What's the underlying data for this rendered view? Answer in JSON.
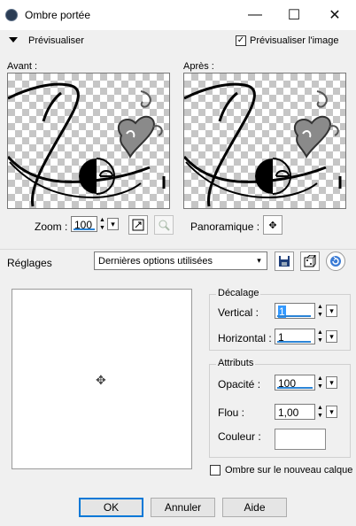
{
  "window": {
    "title": "Ombre portée",
    "minimize_glyph": "—",
    "maximize_glyph": "☐",
    "close_glyph": "✕"
  },
  "preview_toggle": {
    "label": "Prévisualiser",
    "checkbox_label": "Prévisualiser l'image",
    "checked": true
  },
  "before": {
    "label": "Avant :"
  },
  "after": {
    "label": "Après :"
  },
  "zoom": {
    "label": "Zoom :",
    "value": "100"
  },
  "pan": {
    "label": "Panoramique :"
  },
  "settings": {
    "label": "Réglages",
    "preset": "Dernières options utilisées"
  },
  "offset_group": {
    "title": "Décalage",
    "vertical_label": "Vertical :",
    "vertical_value": "1",
    "horizontal_label": "Horizontal :",
    "horizontal_value": "1"
  },
  "attributes_group": {
    "title": "Attributs",
    "opacity_label": "Opacité :",
    "opacity_value": "100",
    "blur_label": "Flou :",
    "blur_value": "1,00",
    "color_label": "Couleur :",
    "color_value": "#ffffff"
  },
  "new_layer": {
    "label": "Ombre sur le nouveau calque",
    "checked": false
  },
  "buttons": {
    "ok": "OK",
    "cancel": "Annuler",
    "help": "Aide"
  }
}
